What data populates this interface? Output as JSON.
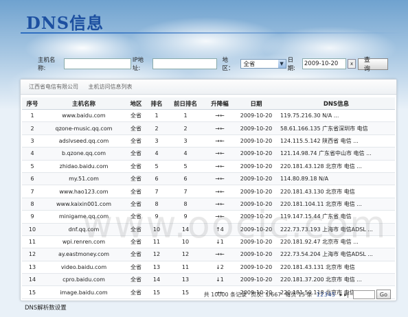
{
  "page": {
    "title": "DNS信息"
  },
  "search": {
    "host_label": "主机名称:",
    "host_value": "",
    "ip_label": "IP地址:",
    "ip_value": "",
    "region_label": "地区：",
    "region_selected": "全省",
    "date_label": "日期:",
    "date_value": "2009-10-20",
    "clear_label": "x",
    "query_label": "查 询"
  },
  "breadcrumb": [
    "江西省电信有限公司",
    "主机访问信息列表"
  ],
  "table": {
    "columns": [
      "序号",
      "主机名称",
      "地区",
      "排名",
      "前日排名",
      "升降幅",
      "日期",
      "DNS信息"
    ],
    "rows": [
      [
        "1",
        "www.baidu.com",
        "全省",
        "1",
        "1",
        "→←",
        "2009-10-20",
        "119.75.216.30 N/A ..."
      ],
      [
        "2",
        "qzone-music.qq.com",
        "全省",
        "2",
        "2",
        "→←",
        "2009-10-20",
        "58.61.166.135 广东省深圳市 电信"
      ],
      [
        "3",
        "adslvseed.qq.com",
        "全省",
        "3",
        "3",
        "→←",
        "2009-10-20",
        "124.115.5.142 陕西省 电信 ..."
      ],
      [
        "4",
        "b.qzone.qq.com",
        "全省",
        "4",
        "4",
        "→←",
        "2009-10-20",
        "121.14.98.74 广东省中山市 电信 ..."
      ],
      [
        "5",
        "zhidao.baidu.com",
        "全省",
        "5",
        "5",
        "→←",
        "2009-10-20",
        "220.181.43.128 北京市 电信 ..."
      ],
      [
        "6",
        "my.51.com",
        "全省",
        "6",
        "6",
        "→←",
        "2009-10-20",
        "114.80.89.18 N/A"
      ],
      [
        "7",
        "www.hao123.com",
        "全省",
        "7",
        "7",
        "→←",
        "2009-10-20",
        "220.181.43.130 北京市 电信"
      ],
      [
        "8",
        "www.kaixin001.com",
        "全省",
        "8",
        "8",
        "→←",
        "2009-10-20",
        "220.181.104.11 北京市 电信 ..."
      ],
      [
        "9",
        "minigame.qq.com",
        "全省",
        "9",
        "9",
        "→←",
        "2009-10-20",
        "119.147.15.44 广东省 电信"
      ],
      [
        "10",
        "dnf.qq.com",
        "全省",
        "10",
        "14",
        "↑4",
        "2009-10-20",
        "222.73.73.193 上海市 电信ADSL ..."
      ],
      [
        "11",
        "wpi.renren.com",
        "全省",
        "11",
        "10",
        "↓1",
        "2009-10-20",
        "220.181.92.47 北京市 电信 ..."
      ],
      [
        "12",
        "ay.eastmoney.com",
        "全省",
        "12",
        "12",
        "→←",
        "2009-10-20",
        "222.73.54.204 上海市 电信ADSL ..."
      ],
      [
        "13",
        "video.baidu.com",
        "全省",
        "13",
        "11",
        "↓2",
        "2009-10-20",
        "220.181.43.131 北京市 电信"
      ],
      [
        "14",
        "cpro.baidu.com",
        "全省",
        "14",
        "13",
        "↓1",
        "2009-10-20",
        "220.181.37.200 北京市 电信 ..."
      ],
      [
        "15",
        "image.baidu.com",
        "全省",
        "15",
        "15",
        "→←",
        "2009-10-20",
        "220.181.50.118 北京市 电信"
      ]
    ]
  },
  "pager": {
    "total": "共 10000 条记录",
    "pages": "页次: 1/667",
    "per_page": "每页 15 条",
    "page_links": "12345",
    "nav": "▸ ▸|",
    "go_label": "Go"
  },
  "footer": {
    "link": "DNS解析数设置"
  },
  "watermark": "www.oocic.com"
}
